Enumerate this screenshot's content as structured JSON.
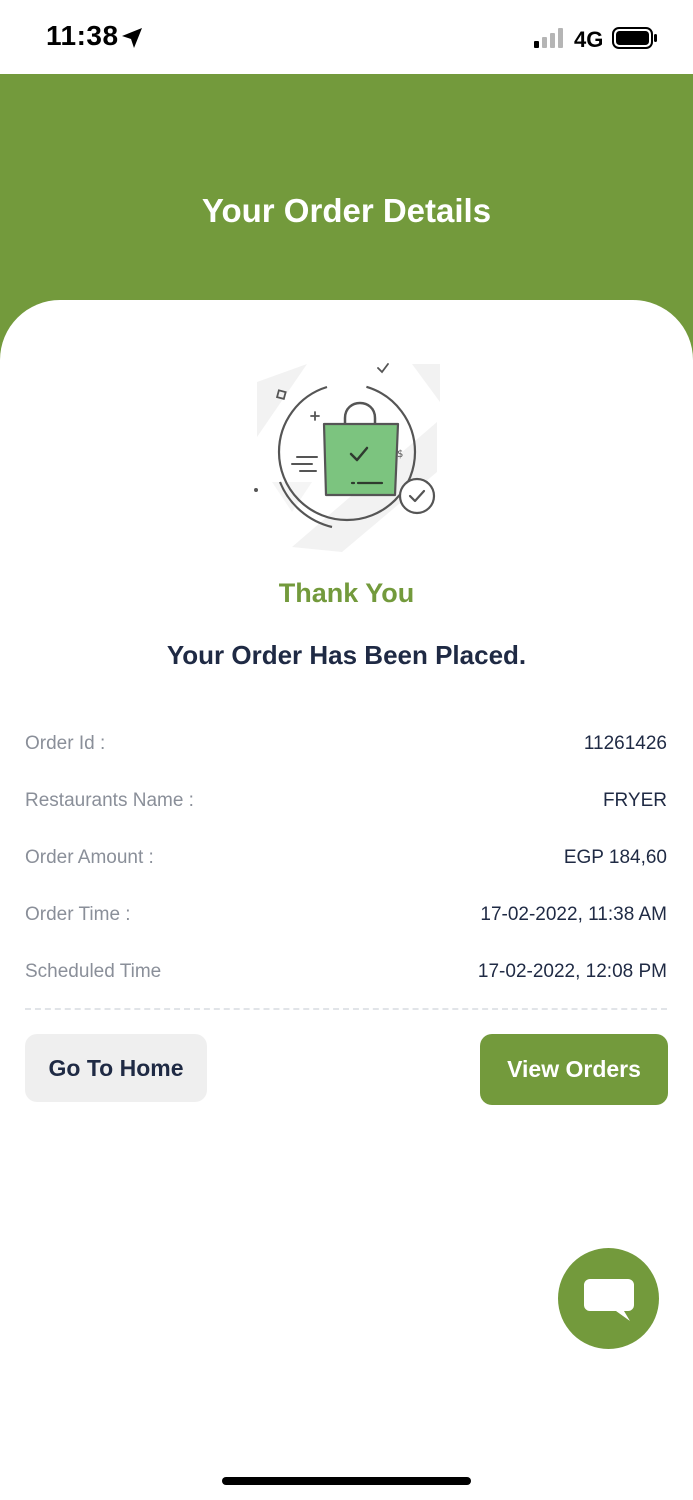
{
  "status_bar": {
    "time": "11:38",
    "network": "4G",
    "icons": [
      "location-arrow-icon",
      "signal-bars-icon",
      "battery-icon"
    ]
  },
  "header": {
    "title": "Your Order Details"
  },
  "illustration": {
    "icon": "shopping-bag-check-icon"
  },
  "confirmation": {
    "thank_you": "Thank You",
    "message": "Your Order Has Been Placed."
  },
  "details": [
    {
      "label": "Order Id :",
      "value": "11261426"
    },
    {
      "label": "Restaurants Name :",
      "value": "FRYER"
    },
    {
      "label": "Order Amount :",
      "value": "EGP 184,60"
    },
    {
      "label": "Order Time :",
      "value": "17-02-2022, 11:38 AM"
    },
    {
      "label": "Scheduled Time",
      "value": "17-02-2022, 12:08 PM"
    }
  ],
  "actions": {
    "home_label": "Go To Home",
    "orders_label": "View Orders"
  },
  "chat": {
    "icon": "chat-bubble-icon"
  },
  "colors": {
    "brand_green": "#739a3c",
    "dark_text": "#1f2a44",
    "muted_text": "#8a8f99",
    "secondary_button_bg": "#efefef",
    "bag_green": "#7cc47f"
  }
}
